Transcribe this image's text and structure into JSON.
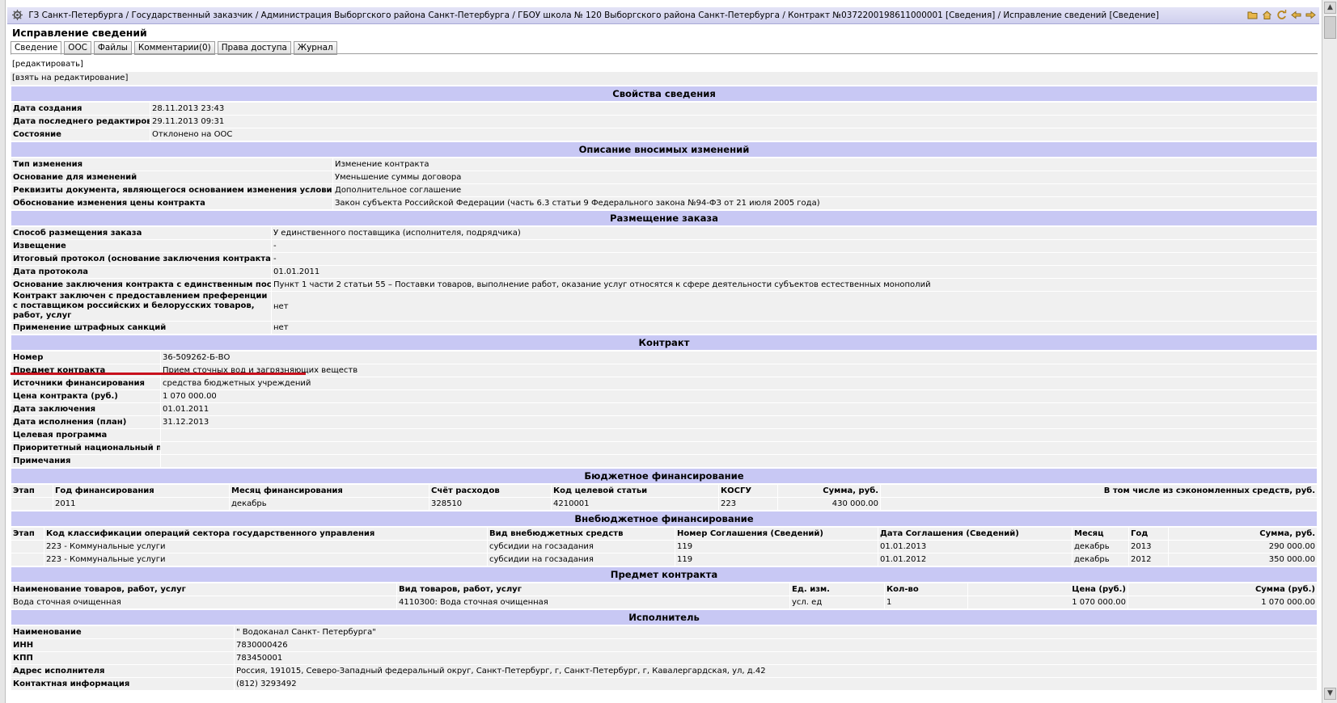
{
  "breadcrumb": {
    "items": [
      "ГЗ Санкт-Петербурга",
      "Государственный заказчик",
      "Администрация Выборгского района Санкт-Петербурга",
      "ГБОУ школа № 120 Выборгского района Санкт-Петербурга",
      "Контракт №0372200198611000001 [Сведения]",
      "Исправление сведений [Сведение]"
    ],
    "separator": " / "
  },
  "toolbar_icons": [
    "folder-icon",
    "home-icon",
    "refresh-icon",
    "back-icon",
    "forward-icon"
  ],
  "page_title": "Исправление сведений",
  "tabs": [
    "Сведение",
    "ООС",
    "Файлы",
    "Комментарии(0)",
    "Права доступа",
    "Журнал"
  ],
  "actions": {
    "edit": "[редактировать]",
    "take": "[взять на редактирование]"
  },
  "sections": {
    "props": {
      "title": "Свойства сведения",
      "rows": [
        {
          "k": "Дата создания",
          "v": "28.11.2013 23:43"
        },
        {
          "k": "Дата последнего редактирования",
          "v": "29.11.2013 09:31"
        },
        {
          "k": "Состояние",
          "v": "Отклонено на ООС"
        }
      ]
    },
    "changes": {
      "title": "Описание вносимых изменений",
      "rows": [
        {
          "k": "Тип изменения",
          "v": "Изменение контракта"
        },
        {
          "k": "Основание для изменений",
          "v": "Уменьшение суммы договора"
        },
        {
          "k": "Реквизиты документа, являющегося основанием изменения условий контракта",
          "v": "Дополнительное соглашение"
        },
        {
          "k": "Обоснование изменения цены контракта",
          "v": "Закон субъекта Российской Федерации (часть 6.3 статьи 9 Федерального закона №94-ФЗ от 21 июля 2005 года)"
        }
      ]
    },
    "placement": {
      "title": "Размещение заказа",
      "rows": [
        {
          "k": "Способ размещения заказа",
          "v": "У единственного поставщика (исполнителя, подрядчика)"
        },
        {
          "k": "Извещение",
          "v": "-"
        },
        {
          "k": "Итоговый протокол (основание заключения контракта)",
          "v": "-"
        },
        {
          "k": "Дата протокола",
          "v": "01.01.2011"
        },
        {
          "k": "Основание заключения контракта с единственным поставщиком",
          "v": "Пункт 1 части 2 статьи 55 – Поставки товаров, выполнение работ, оказание услуг относятся к сфере деятельности субъектов естественных монополий"
        },
        {
          "k": "Контракт заключен с предоставлением преференции с поставщиком российских и белорусских товаров, работ, услуг",
          "v": "нет"
        },
        {
          "k": "Применение штрафных санкций",
          "v": "нет"
        }
      ]
    },
    "contract": {
      "title": "Контракт",
      "rows": [
        {
          "k": "Номер",
          "v": "36-509262-Б-ВО"
        },
        {
          "k": "Предмет контракта",
          "v": "Прием сточных вод и загрязняющих веществ"
        },
        {
          "k": "Источники финансирования",
          "v": "средства бюджетных учреждений"
        },
        {
          "k": "Цена контракта (руб.)",
          "v": "1 070 000.00"
        },
        {
          "k": "Дата заключения",
          "v": "01.01.2011"
        },
        {
          "k": "Дата исполнения (план)",
          "v": "31.12.2013"
        },
        {
          "k": "Целевая программа",
          "v": ""
        },
        {
          "k": "Приоритетный национальный проект",
          "v": ""
        },
        {
          "k": "Примечания",
          "v": ""
        }
      ]
    },
    "budget": {
      "title": "Бюджетное финансирование",
      "headers": [
        "Этап",
        "Год финансирования",
        "Месяц финансирования",
        "Счёт расходов",
        "Код целевой статьи",
        "КОСГУ",
        "Сумма, руб.",
        "В том числе из сэкономленных средств, руб."
      ],
      "rows": [
        [
          "",
          "2011",
          "декабрь",
          "328510",
          "4210001",
          "223",
          "430 000.00",
          ""
        ]
      ]
    },
    "extrabudget": {
      "title": "Внебюджетное финансирование",
      "headers": [
        "Этап",
        "Код классификации операций сектора государственного управления",
        "Вид внебюджетных средств",
        "Номер Соглашения (Сведений)",
        "Дата Соглашения (Сведений)",
        "Месяц",
        "Год",
        "Сумма, руб."
      ],
      "rows": [
        [
          "",
          "223 - Коммунальные услуги",
          "субсидии на госзадания",
          "119",
          "01.01.2013",
          "декабрь",
          "2013",
          "290 000.00"
        ],
        [
          "",
          "223 - Коммунальные услуги",
          "субсидии на госзадания",
          "119",
          "01.01.2012",
          "декабрь",
          "2012",
          "350 000.00"
        ]
      ]
    },
    "subject": {
      "title": "Предмет контракта",
      "headers": [
        "Наименование товаров, работ, услуг",
        "Вид товаров, работ, услуг",
        "Ед. изм.",
        "Кол-во",
        "Цена (руб.)",
        "Сумма (руб.)"
      ],
      "rows": [
        [
          "Вода сточная очищенная",
          "4110300: Вода сточная очищенная",
          "усл. ед",
          "1",
          "1 070 000.00",
          "1 070 000.00"
        ]
      ]
    },
    "executor": {
      "title": "Исполнитель",
      "rows": [
        {
          "k": "Наименование",
          "v": "\" Водоканал Санкт- Петербурга\""
        },
        {
          "k": "ИНН",
          "v": "7830000426"
        },
        {
          "k": "КПП",
          "v": "783450001"
        },
        {
          "k": "Адрес исполнителя",
          "v": "Россия, 191015, Северо-Западный федеральный округ, Санкт-Петербург, г, Санкт-Петербург, г, Кавалергардская, ул, д.42"
        },
        {
          "k": "Контактная информация",
          "v": "(812) 3293492"
        }
      ]
    }
  },
  "colors": {
    "section_bg": "#c8c8f4",
    "row_bg": "#f0f0f0",
    "highlight_line": "#c8101c"
  }
}
